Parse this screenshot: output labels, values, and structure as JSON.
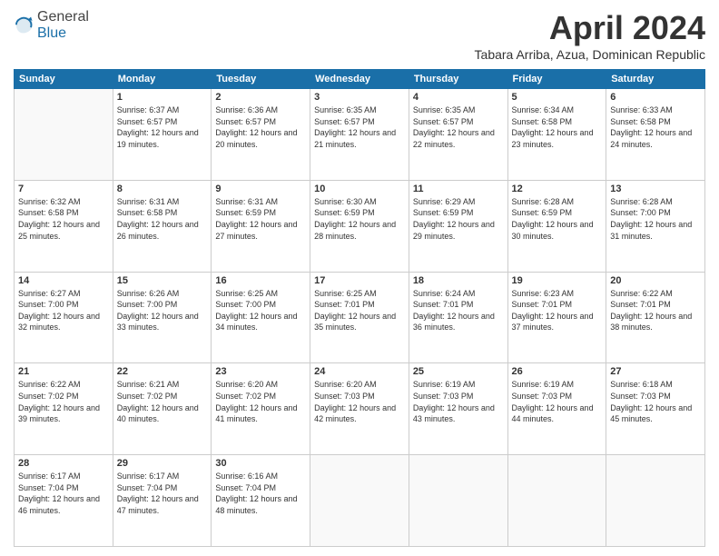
{
  "header": {
    "logo_general": "General",
    "logo_blue": "Blue",
    "month_title": "April 2024",
    "subtitle": "Tabara Arriba, Azua, Dominican Republic"
  },
  "days_of_week": [
    "Sunday",
    "Monday",
    "Tuesday",
    "Wednesday",
    "Thursday",
    "Friday",
    "Saturday"
  ],
  "weeks": [
    [
      {
        "day": "",
        "sunrise": "",
        "sunset": "",
        "daylight": ""
      },
      {
        "day": "1",
        "sunrise": "Sunrise: 6:37 AM",
        "sunset": "Sunset: 6:57 PM",
        "daylight": "Daylight: 12 hours and 19 minutes."
      },
      {
        "day": "2",
        "sunrise": "Sunrise: 6:36 AM",
        "sunset": "Sunset: 6:57 PM",
        "daylight": "Daylight: 12 hours and 20 minutes."
      },
      {
        "day": "3",
        "sunrise": "Sunrise: 6:35 AM",
        "sunset": "Sunset: 6:57 PM",
        "daylight": "Daylight: 12 hours and 21 minutes."
      },
      {
        "day": "4",
        "sunrise": "Sunrise: 6:35 AM",
        "sunset": "Sunset: 6:57 PM",
        "daylight": "Daylight: 12 hours and 22 minutes."
      },
      {
        "day": "5",
        "sunrise": "Sunrise: 6:34 AM",
        "sunset": "Sunset: 6:58 PM",
        "daylight": "Daylight: 12 hours and 23 minutes."
      },
      {
        "day": "6",
        "sunrise": "Sunrise: 6:33 AM",
        "sunset": "Sunset: 6:58 PM",
        "daylight": "Daylight: 12 hours and 24 minutes."
      }
    ],
    [
      {
        "day": "7",
        "sunrise": "Sunrise: 6:32 AM",
        "sunset": "Sunset: 6:58 PM",
        "daylight": "Daylight: 12 hours and 25 minutes."
      },
      {
        "day": "8",
        "sunrise": "Sunrise: 6:31 AM",
        "sunset": "Sunset: 6:58 PM",
        "daylight": "Daylight: 12 hours and 26 minutes."
      },
      {
        "day": "9",
        "sunrise": "Sunrise: 6:31 AM",
        "sunset": "Sunset: 6:59 PM",
        "daylight": "Daylight: 12 hours and 27 minutes."
      },
      {
        "day": "10",
        "sunrise": "Sunrise: 6:30 AM",
        "sunset": "Sunset: 6:59 PM",
        "daylight": "Daylight: 12 hours and 28 minutes."
      },
      {
        "day": "11",
        "sunrise": "Sunrise: 6:29 AM",
        "sunset": "Sunset: 6:59 PM",
        "daylight": "Daylight: 12 hours and 29 minutes."
      },
      {
        "day": "12",
        "sunrise": "Sunrise: 6:28 AM",
        "sunset": "Sunset: 6:59 PM",
        "daylight": "Daylight: 12 hours and 30 minutes."
      },
      {
        "day": "13",
        "sunrise": "Sunrise: 6:28 AM",
        "sunset": "Sunset: 7:00 PM",
        "daylight": "Daylight: 12 hours and 31 minutes."
      }
    ],
    [
      {
        "day": "14",
        "sunrise": "Sunrise: 6:27 AM",
        "sunset": "Sunset: 7:00 PM",
        "daylight": "Daylight: 12 hours and 32 minutes."
      },
      {
        "day": "15",
        "sunrise": "Sunrise: 6:26 AM",
        "sunset": "Sunset: 7:00 PM",
        "daylight": "Daylight: 12 hours and 33 minutes."
      },
      {
        "day": "16",
        "sunrise": "Sunrise: 6:25 AM",
        "sunset": "Sunset: 7:00 PM",
        "daylight": "Daylight: 12 hours and 34 minutes."
      },
      {
        "day": "17",
        "sunrise": "Sunrise: 6:25 AM",
        "sunset": "Sunset: 7:01 PM",
        "daylight": "Daylight: 12 hours and 35 minutes."
      },
      {
        "day": "18",
        "sunrise": "Sunrise: 6:24 AM",
        "sunset": "Sunset: 7:01 PM",
        "daylight": "Daylight: 12 hours and 36 minutes."
      },
      {
        "day": "19",
        "sunrise": "Sunrise: 6:23 AM",
        "sunset": "Sunset: 7:01 PM",
        "daylight": "Daylight: 12 hours and 37 minutes."
      },
      {
        "day": "20",
        "sunrise": "Sunrise: 6:22 AM",
        "sunset": "Sunset: 7:01 PM",
        "daylight": "Daylight: 12 hours and 38 minutes."
      }
    ],
    [
      {
        "day": "21",
        "sunrise": "Sunrise: 6:22 AM",
        "sunset": "Sunset: 7:02 PM",
        "daylight": "Daylight: 12 hours and 39 minutes."
      },
      {
        "day": "22",
        "sunrise": "Sunrise: 6:21 AM",
        "sunset": "Sunset: 7:02 PM",
        "daylight": "Daylight: 12 hours and 40 minutes."
      },
      {
        "day": "23",
        "sunrise": "Sunrise: 6:20 AM",
        "sunset": "Sunset: 7:02 PM",
        "daylight": "Daylight: 12 hours and 41 minutes."
      },
      {
        "day": "24",
        "sunrise": "Sunrise: 6:20 AM",
        "sunset": "Sunset: 7:03 PM",
        "daylight": "Daylight: 12 hours and 42 minutes."
      },
      {
        "day": "25",
        "sunrise": "Sunrise: 6:19 AM",
        "sunset": "Sunset: 7:03 PM",
        "daylight": "Daylight: 12 hours and 43 minutes."
      },
      {
        "day": "26",
        "sunrise": "Sunrise: 6:19 AM",
        "sunset": "Sunset: 7:03 PM",
        "daylight": "Daylight: 12 hours and 44 minutes."
      },
      {
        "day": "27",
        "sunrise": "Sunrise: 6:18 AM",
        "sunset": "Sunset: 7:03 PM",
        "daylight": "Daylight: 12 hours and 45 minutes."
      }
    ],
    [
      {
        "day": "28",
        "sunrise": "Sunrise: 6:17 AM",
        "sunset": "Sunset: 7:04 PM",
        "daylight": "Daylight: 12 hours and 46 minutes."
      },
      {
        "day": "29",
        "sunrise": "Sunrise: 6:17 AM",
        "sunset": "Sunset: 7:04 PM",
        "daylight": "Daylight: 12 hours and 47 minutes."
      },
      {
        "day": "30",
        "sunrise": "Sunrise: 6:16 AM",
        "sunset": "Sunset: 7:04 PM",
        "daylight": "Daylight: 12 hours and 48 minutes."
      },
      {
        "day": "",
        "sunrise": "",
        "sunset": "",
        "daylight": ""
      },
      {
        "day": "",
        "sunrise": "",
        "sunset": "",
        "daylight": ""
      },
      {
        "day": "",
        "sunrise": "",
        "sunset": "",
        "daylight": ""
      },
      {
        "day": "",
        "sunrise": "",
        "sunset": "",
        "daylight": ""
      }
    ]
  ]
}
